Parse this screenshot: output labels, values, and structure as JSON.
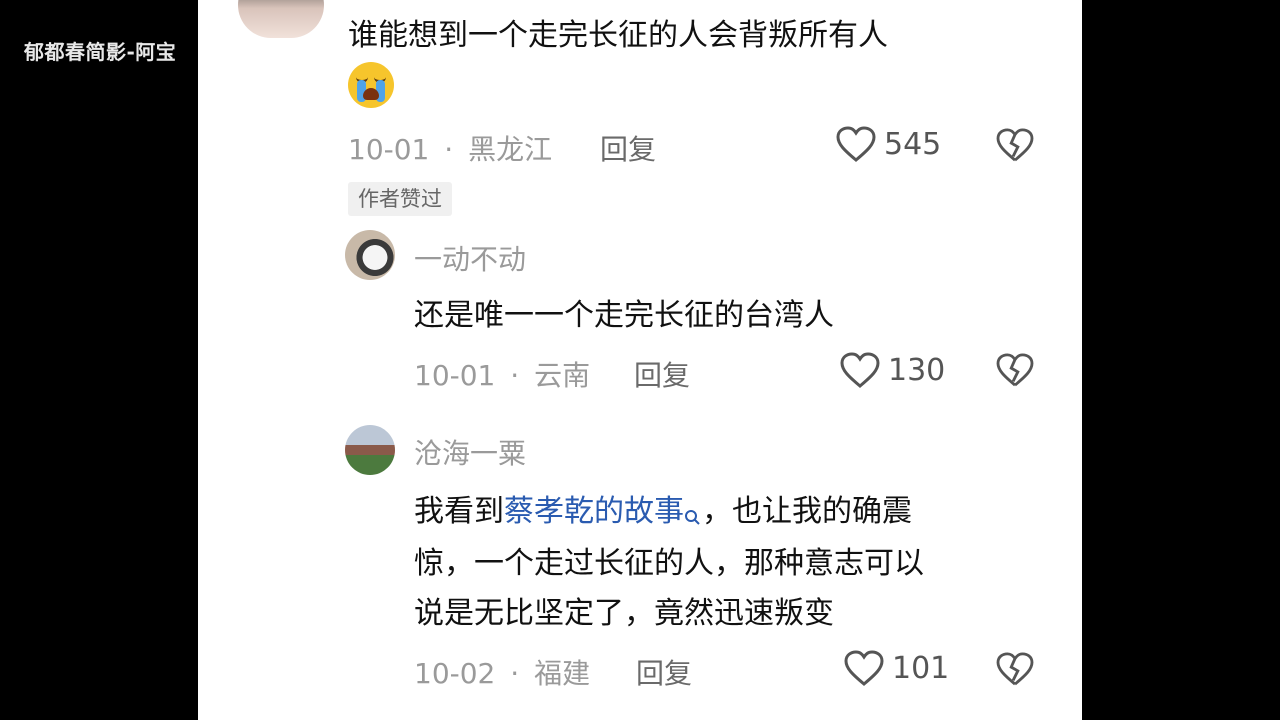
{
  "watermark": {
    "text": "郁都春简影-阿宝",
    "logo": "bilibili"
  },
  "comments": [
    {
      "text": "谁能想到一个走完长征的人会背叛所有人",
      "emoji": "crying-face-emoji",
      "date": "10-01",
      "location": "黑龙江",
      "reply_label": "回复",
      "likes": "545",
      "badge": "作者赞过"
    },
    {
      "username": "一动不动",
      "text": "还是唯一一个走完长征的台湾人",
      "date": "10-01",
      "location": "云南",
      "reply_label": "回复",
      "likes": "130"
    },
    {
      "username": "沧海一粟",
      "text_before": "我看到",
      "link": "蔡孝乾的故事",
      "text_line1_after": "，也让我的确震",
      "text_line2": "惊，一个走过长征的人，那种意志可以",
      "text_line3": "说是无比坚定了，竟然迅速叛变",
      "date": "10-02",
      "location": "福建",
      "reply_label": "回复",
      "likes": "101"
    }
  ],
  "separator": "·",
  "icons": {
    "like": "heart-icon",
    "dislike": "broken-heart-icon",
    "search": "search-icon"
  },
  "colors": {
    "link": "#2a5bb0",
    "meta": "#9a9a9a",
    "background": "#ffffff"
  }
}
